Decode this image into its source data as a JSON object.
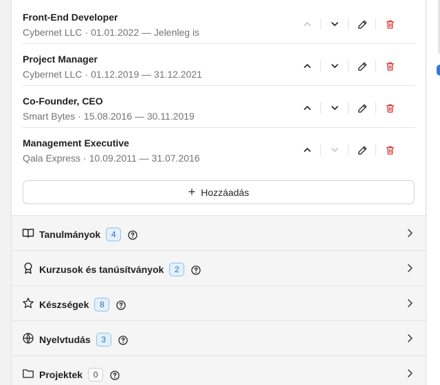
{
  "experience": [
    {
      "title": "Front-End Developer",
      "company": "Cybernet LLC",
      "dates": "01.01.2022 — Jelenleg is",
      "up_disabled": true,
      "down_disabled": false
    },
    {
      "title": "Project Manager",
      "company": "Cybernet LLC",
      "dates": "01.12.2019 — 31.12.2021",
      "up_disabled": false,
      "down_disabled": false
    },
    {
      "title": "Co-Founder, CEO",
      "company": "Smart Bytes",
      "dates": "15.08.2016 — 30.11.2019",
      "up_disabled": false,
      "down_disabled": false
    },
    {
      "title": "Management Executive",
      "company": "Qala Express",
      "dates": "10.09.2011 — 31.07.2016",
      "up_disabled": false,
      "down_disabled": true
    }
  ],
  "separator": "·",
  "add_button": {
    "label": "Hozzáadás"
  },
  "sections": [
    {
      "label": "Tanulmányok",
      "count": "4",
      "icon": "book-icon",
      "badge_style": "blue"
    },
    {
      "label": "Kurzusok és tanúsítványok",
      "count": "2",
      "icon": "award-icon",
      "badge_style": "blue"
    },
    {
      "label": "Készségek",
      "count": "8",
      "icon": "star-icon",
      "badge_style": "blue"
    },
    {
      "label": "Nyelvtudás",
      "count": "3",
      "icon": "globe-icon",
      "badge_style": "blue"
    },
    {
      "label": "Projektek",
      "count": "0",
      "icon": "folder-icon",
      "badge_style": "gray"
    }
  ],
  "colors": {
    "delete": "#d93636",
    "accent": "#2f7bd6",
    "badge_blue_bg": "#e3f0fb"
  }
}
